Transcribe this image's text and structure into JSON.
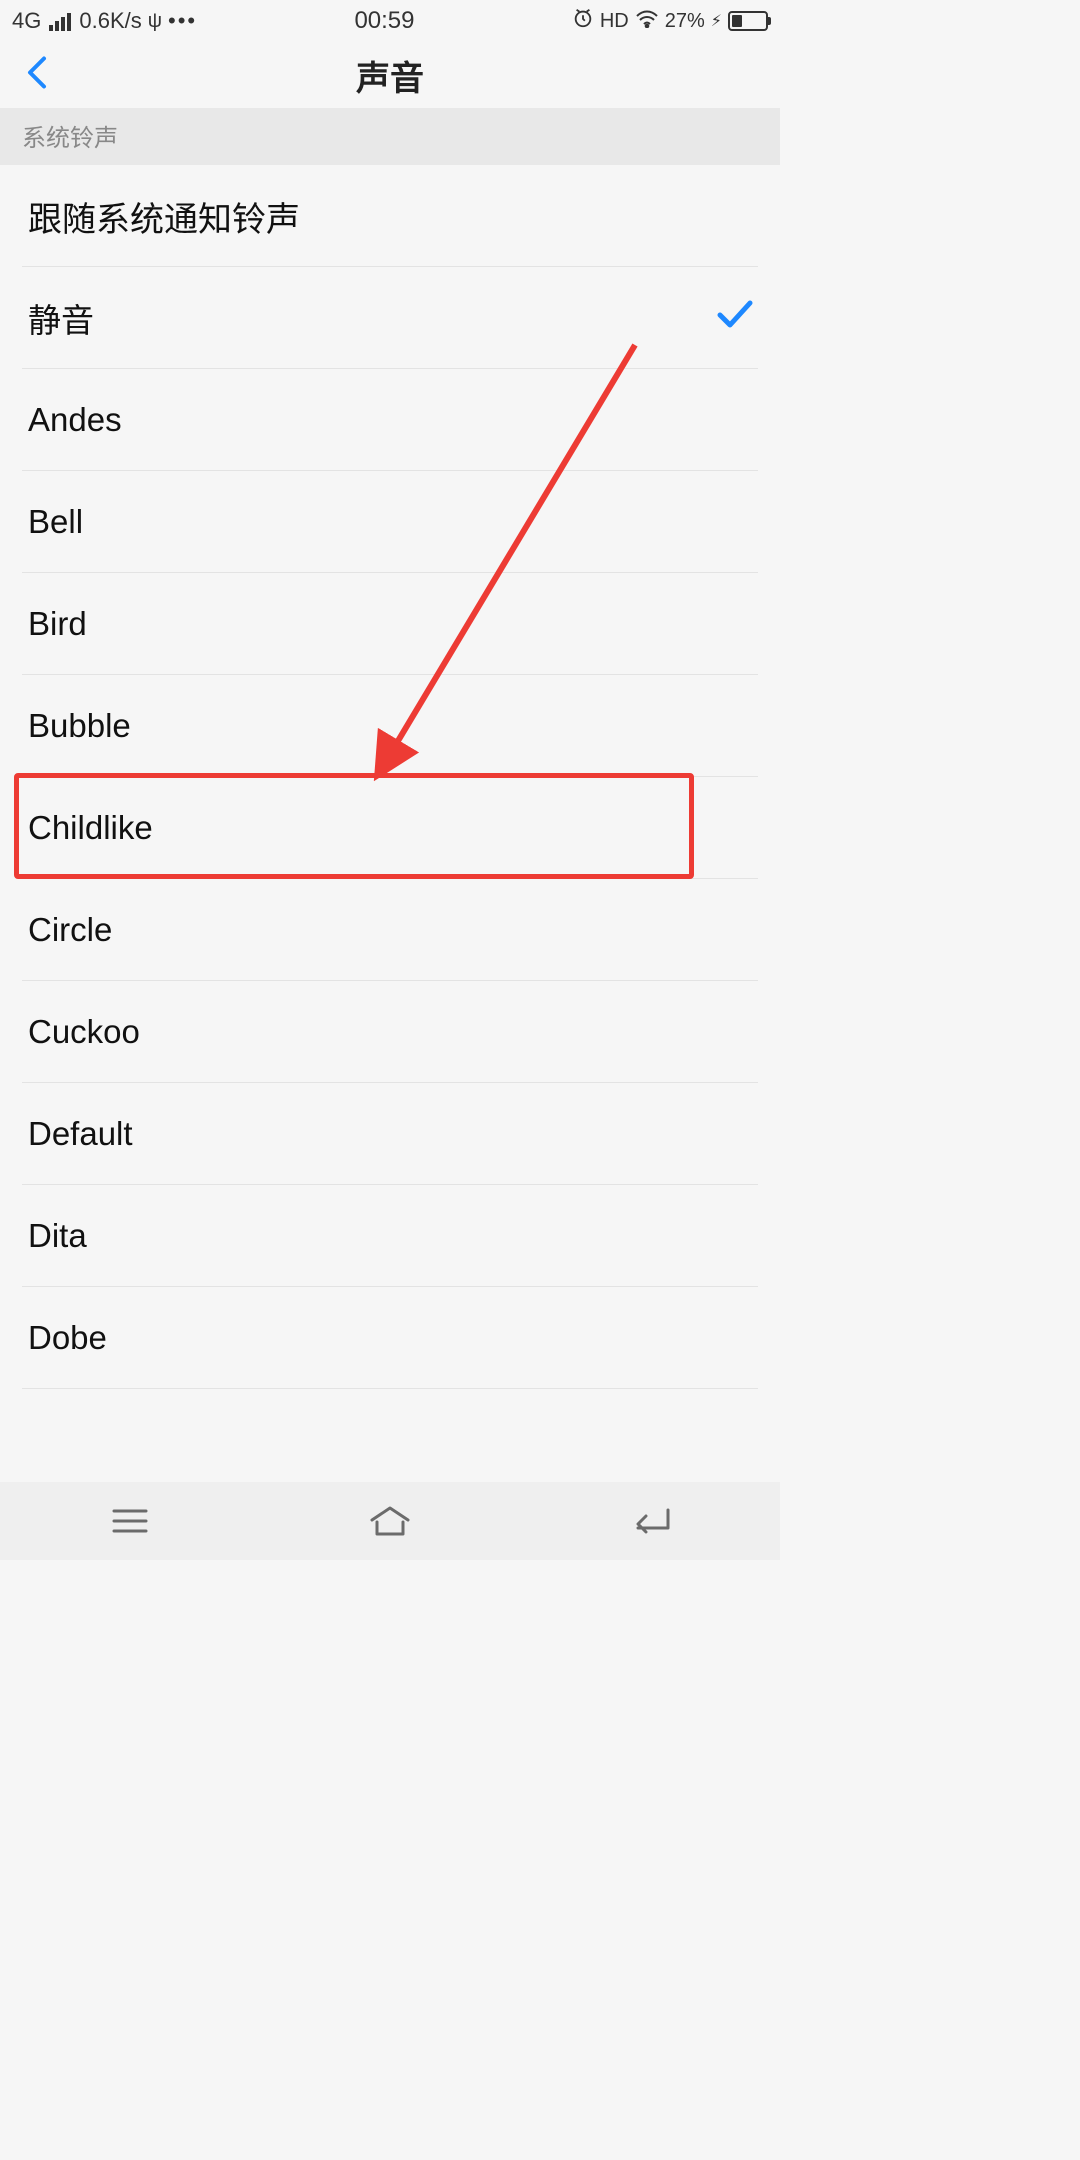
{
  "status": {
    "network": "4G",
    "speed": "0.6K/s",
    "time": "00:59",
    "hd": "HD",
    "battery_pct": "27%"
  },
  "header": {
    "title": "声音"
  },
  "section": {
    "label": "系统铃声"
  },
  "items": [
    {
      "label": "跟随系统通知铃声",
      "selected": false
    },
    {
      "label": "静音",
      "selected": true
    },
    {
      "label": "Andes",
      "selected": false
    },
    {
      "label": "Bell",
      "selected": false
    },
    {
      "label": "Bird",
      "selected": false
    },
    {
      "label": "Bubble",
      "selected": false
    },
    {
      "label": "Childlike",
      "selected": false
    },
    {
      "label": "Circle",
      "selected": false
    },
    {
      "label": "Cuckoo",
      "selected": false
    },
    {
      "label": "Default",
      "selected": false
    },
    {
      "label": "Dita",
      "selected": false
    },
    {
      "label": "Dobe",
      "selected": false
    }
  ],
  "annotation": {
    "highlight_index": 6,
    "color": "#ed3b34"
  }
}
